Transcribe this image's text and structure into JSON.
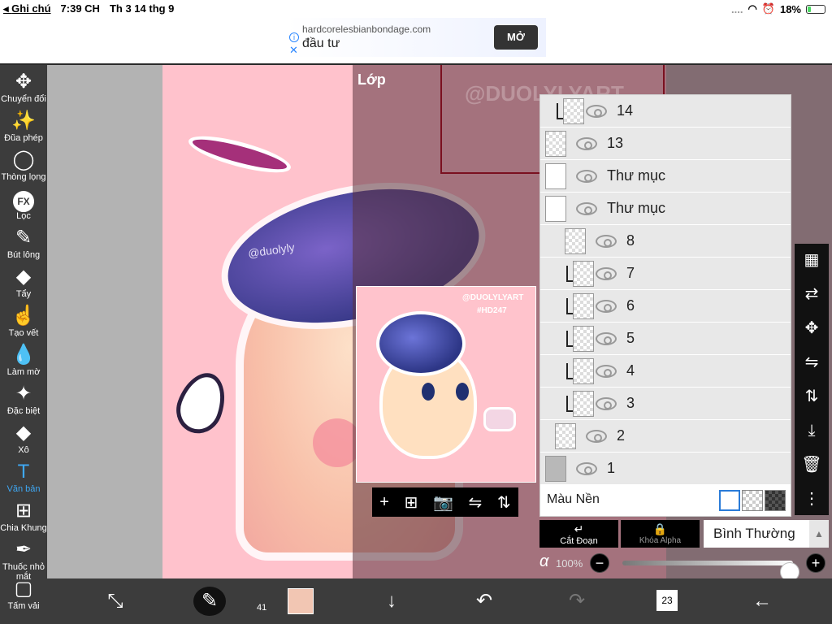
{
  "status": {
    "back_label": "Ghi chú",
    "time": "7:39 CH",
    "date": "Th 3 14 thg 9",
    "dots": "....",
    "battery": "18%",
    "battery_level": 0.18
  },
  "ad": {
    "url": "hardcorelesbianbondage.com",
    "title": "đầu tư",
    "button": "MỞ"
  },
  "tools": [
    {
      "label": "Chuyển đổi",
      "icon": "move-icon",
      "glyph": "✥"
    },
    {
      "label": "Đũa phép",
      "icon": "magic-wand-icon",
      "glyph": "✨"
    },
    {
      "label": "Thòng lọng",
      "icon": "lasso-icon",
      "glyph": "◯"
    },
    {
      "label": "Lọc",
      "icon": "filter-fx-icon",
      "glyph": "FX"
    },
    {
      "label": "Bút lông",
      "icon": "brush-icon",
      "glyph": "✎"
    },
    {
      "label": "Tẩy",
      "icon": "eraser-icon",
      "glyph": "◆"
    },
    {
      "label": "Tạo vết",
      "icon": "smudge-icon",
      "glyph": "☝"
    },
    {
      "label": "Làm mờ",
      "icon": "blur-drop-icon",
      "glyph": "💧"
    },
    {
      "label": "Đặc biệt",
      "icon": "special-icon",
      "glyph": "✦"
    },
    {
      "label": "Xô",
      "icon": "bucket-icon",
      "glyph": "◆"
    },
    {
      "label": "Văn bản",
      "icon": "text-icon",
      "glyph": "T"
    },
    {
      "label": "Chia Khung",
      "icon": "frame-divider-icon",
      "glyph": "⊞"
    },
    {
      "label": "Thuốc nhỏ mắt",
      "icon": "eyedropper-icon",
      "glyph": "✒"
    },
    {
      "label": "Tấm vải",
      "icon": "canvas-icon",
      "glyph": "▢"
    }
  ],
  "active_tool": "Văn bản",
  "layers_panel": {
    "title": "Lớp",
    "watermark": "@DUOLYLYART",
    "preview_watermark_1": "@DUOLYLYART",
    "preview_watermark_2": "#HD247",
    "art_watermark": "@duolyly",
    "layers": [
      {
        "name": "14",
        "clipped": true,
        "indent": 1
      },
      {
        "name": "13",
        "clipped": false,
        "indent": 0
      },
      {
        "name": "Thư mục",
        "clipped": false,
        "indent": 0,
        "folder": true
      },
      {
        "name": "Thư mục",
        "clipped": false,
        "indent": 0,
        "folder": true
      },
      {
        "name": "8",
        "clipped": false,
        "indent": 2
      },
      {
        "name": "7",
        "clipped": true,
        "indent": 2
      },
      {
        "name": "6",
        "clipped": true,
        "indent": 2
      },
      {
        "name": "5",
        "clipped": true,
        "indent": 2
      },
      {
        "name": "4",
        "clipped": true,
        "indent": 2
      },
      {
        "name": "3",
        "clipped": true,
        "indent": 2
      },
      {
        "name": "2",
        "clipped": false,
        "indent": 1
      },
      {
        "name": "1",
        "clipped": false,
        "indent": 0
      }
    ],
    "background_label": "Màu Nền",
    "clip_label": "Cắt Đoạn",
    "alpha_lock_label": "Khóa Alpha",
    "blend_mode": "Bình Thường",
    "alpha_symbol": "α",
    "opacity": "100%",
    "opacity_level": 1.0
  },
  "bottom": {
    "brush_size": "41",
    "pages": "23",
    "color": "#f2c6b3"
  },
  "colors": {
    "toolbar_bg": "#3c3c3c",
    "active_tool": "#3fa8f4",
    "canvas_pink": "#ffc2cc"
  }
}
